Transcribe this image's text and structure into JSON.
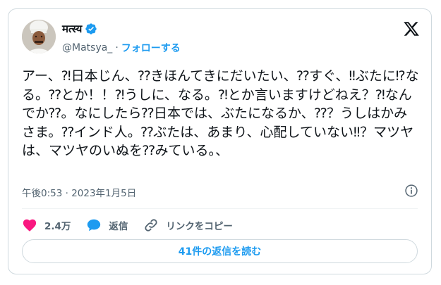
{
  "author": {
    "display_name": "मत्स्य",
    "handle": "@Matsya_",
    "separator": "·",
    "follow_label": "フォローする",
    "verified_color": "#1d9bf0"
  },
  "tweet": {
    "text": "アー、⁈日本じん、⁇きほんてきにだいたい、⁇すぐ、‼ぶたに⁉なる。⁇とか！！⁈うしに、なる。⁈とか言いますけどねえ？⁈なんでか⁇。なにしたら⁇日本では、ぶたになるか、⁇？うしはかみさま。⁇インド人。⁇ぶたは、あまり、心配していない‼？マツヤは、マツヤのいぬを⁇みている。、",
    "timestamp": "午後0:53 · 2023年1月5日"
  },
  "actions": {
    "like_count": "2.4万",
    "reply_label": "返信",
    "copy_link_label": "リンクをコピー",
    "like_color": "#f91880",
    "reply_color": "#1d9bf0"
  },
  "replies_button": {
    "label": "41件の返信を読む"
  },
  "icons": {
    "logo": "x-logo-icon",
    "verified": "verified-badge-icon",
    "info": "info-icon",
    "like": "heart-icon",
    "reply": "speech-bubble-icon",
    "link": "link-icon"
  }
}
